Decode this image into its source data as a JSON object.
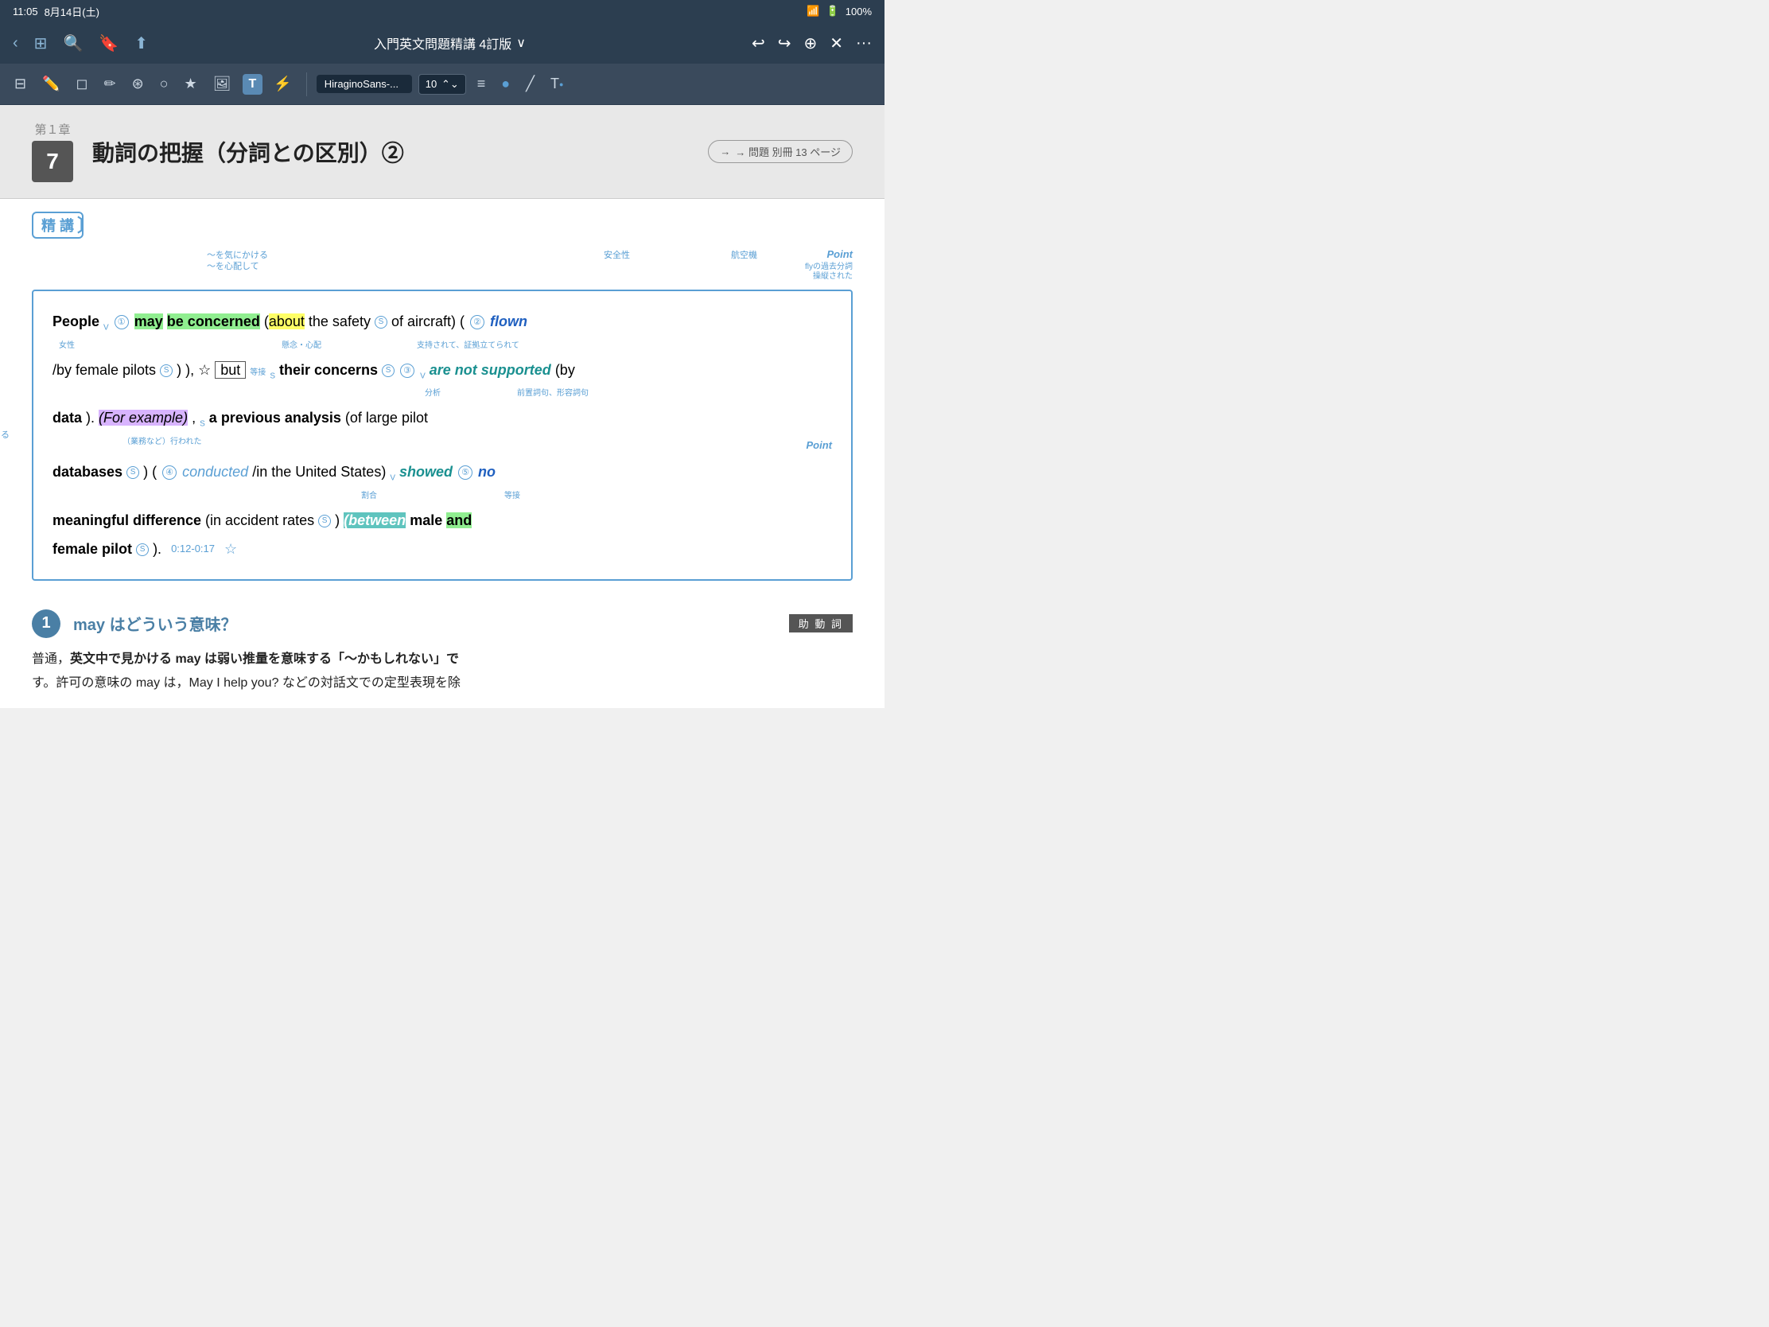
{
  "statusBar": {
    "time": "11:05",
    "date": "8月14日(土)",
    "wifi": "WiFi",
    "battery": "100%"
  },
  "navBar": {
    "title": "入門英文問題精講 4訂版",
    "titleDropdown": "▼"
  },
  "toolbar": {
    "fontName": "HiraginoSans-...",
    "fontSize": "10",
    "icons": [
      "sidebar",
      "pencil",
      "eraser",
      "pencil2",
      "stamp",
      "circle",
      "star",
      "image",
      "T",
      "wand",
      "lines",
      "circle2",
      "stroke",
      "T2"
    ]
  },
  "chapter": {
    "label": "第１章",
    "number": "7",
    "title": "動詞の把握（分詞との区別）②",
    "ref": "→ 問題 別冊 13 ページ"
  },
  "sectionLabel": "精 講",
  "mainText": {
    "line1_annots": {
      "care": "〜を気にかける",
      "worry": "〜を心配して",
      "safety": "安全性",
      "aircraft": "航空機",
      "point1": "Point",
      "flown_annot1": "flyの過去分詞",
      "flown_annot2": "操縦された"
    },
    "line1": "People may be concerned (about the safety of aircraft) ( flown",
    "line2_annots": {
      "female": "女性",
      "concern": "懸念・心配",
      "support": "支持されて、証拠立てられて"
    },
    "line2": "/by female pilots(S) ), but their concerns(S) are not supported (by",
    "line3_annots": {
      "analysis": "分析",
      "prepphrase": "前置詞句、形容詞句"
    },
    "line3": "data). (For example), a previous analysis (of large pilot",
    "line4_annots": {
      "conducted": "（業務など）行われた",
      "point2": "Point"
    },
    "line4": "databases(S) ) ( conducted/in the United States) showed no",
    "line5_annots": {
      "ratio": "割合",
      "conj": "等接"
    },
    "line5": "meaningful difference (in accident rates(S) ) (between male and",
    "line6": "female pilots(S) ).",
    "timestamp": "0:12-0:17",
    "numLabels": [
      "①",
      "②",
      "③",
      "④",
      "⑤"
    ]
  },
  "section1": {
    "number": "1",
    "question": "may はどういう意味？",
    "badge": "助 動 詞",
    "body1": "普通，英文中で見かける may は弱い推量を意味する「〜かもしれない」で",
    "body2": "す。許可の意味の may は，May I help you? などの対話文での定型表現を除"
  }
}
